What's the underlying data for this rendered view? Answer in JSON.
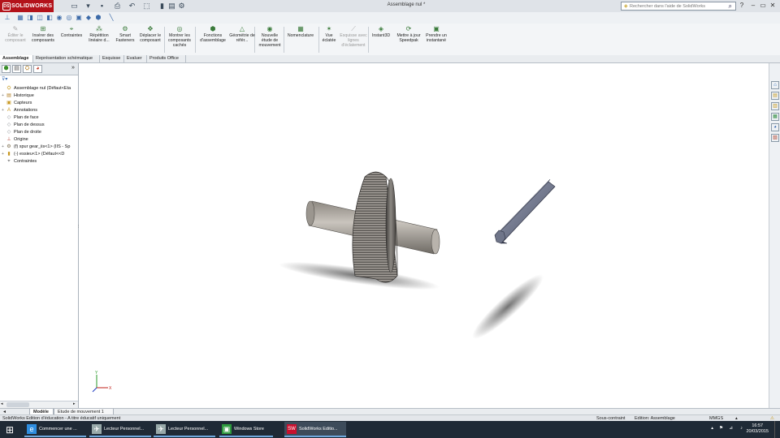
{
  "app": {
    "brand": "SOLIDWORKS",
    "ds_logo": "DS",
    "doc_title": "Assemblage nul *",
    "search_placeholder": "Rechercher dans l'aide de SolidWorks",
    "help_label": "?"
  },
  "quick_access": [
    {
      "name": "new-doc",
      "glyph": "▭"
    },
    {
      "name": "open",
      "glyph": "▾"
    },
    {
      "name": "save",
      "glyph": "▪"
    },
    {
      "name": "print",
      "glyph": "⎙"
    },
    {
      "name": "undo",
      "glyph": "↶"
    },
    {
      "name": "select",
      "glyph": "⬚"
    },
    {
      "name": "rebuild",
      "glyph": "▮"
    },
    {
      "name": "file-props",
      "glyph": "▤"
    },
    {
      "name": "options",
      "glyph": "⚙"
    }
  ],
  "command_manager": [
    {
      "label": "Éditer le composant",
      "glyph": "✎",
      "disabled": true
    },
    {
      "label": "Insérer des composants",
      "glyph": "⊞",
      "disabled": false
    },
    {
      "label": "Contraintes",
      "glyph": "⌖",
      "disabled": false
    },
    {
      "label": "Répétition linéaire d...",
      "glyph": "⁂",
      "disabled": false
    },
    {
      "label": "Smart Fasteners",
      "glyph": "⚙",
      "disabled": false
    },
    {
      "label": "Déplacer le composant",
      "glyph": "✥",
      "disabled": false
    },
    {
      "label": "Montrer les composants cachés",
      "glyph": "◎",
      "disabled": false
    },
    {
      "label": "Fonctions d'assemblage",
      "glyph": "⬢",
      "disabled": false
    },
    {
      "label": "Géométrie de référ...",
      "glyph": "△",
      "disabled": false
    },
    {
      "label": "Nouvelle étude de mouvement",
      "glyph": "◉",
      "disabled": false
    },
    {
      "label": "Nomenclature",
      "glyph": "▦",
      "disabled": false
    },
    {
      "label": "Vue éclatée",
      "glyph": "✶",
      "disabled": false
    },
    {
      "label": "Esquisse avec lignes d'éclatement",
      "glyph": "⟋",
      "disabled": true
    },
    {
      "label": "Instant3D",
      "glyph": "◈",
      "disabled": false
    },
    {
      "label": "Mettre à jour Speedpak",
      "glyph": "⟳",
      "disabled": false
    },
    {
      "label": "Prendre un instantané",
      "glyph": "▣",
      "disabled": false
    }
  ],
  "tabs": [
    {
      "label": "Assemblage",
      "active": true
    },
    {
      "label": "Représentation schématique",
      "active": false
    },
    {
      "label": "Esquisse",
      "active": false
    },
    {
      "label": "Evaluer",
      "active": false
    },
    {
      "label": "Produits Office",
      "active": false
    }
  ],
  "feature_tree": [
    {
      "label": "Assemblage nul  (Défaut<Eta",
      "icon": "⛭",
      "color": "#c79a1f",
      "indent": 0,
      "pm": ""
    },
    {
      "label": "Historique",
      "icon": "▤",
      "color": "#b07b1e",
      "indent": 1,
      "pm": "+"
    },
    {
      "label": "Capteurs",
      "icon": "▣",
      "color": "#c7961e",
      "indent": 1,
      "pm": ""
    },
    {
      "label": "Annotations",
      "icon": "A",
      "color": "#c7961e",
      "indent": 1,
      "pm": "+"
    },
    {
      "label": "Plan de face",
      "icon": "◇",
      "color": "#8a8f95",
      "indent": 1,
      "pm": ""
    },
    {
      "label": "Plan de dessus",
      "icon": "◇",
      "color": "#8a8f95",
      "indent": 1,
      "pm": ""
    },
    {
      "label": "Plan de droite",
      "icon": "◇",
      "color": "#8a8f95",
      "indent": 1,
      "pm": ""
    },
    {
      "label": "Origine",
      "icon": "⊥",
      "color": "#b23b2b",
      "indent": 1,
      "pm": ""
    },
    {
      "label": "(f) spur gear_iis<1> (IIS - Sp",
      "icon": "⚙",
      "color": "#7a6a4a",
      "indent": 1,
      "pm": "+"
    },
    {
      "label": "(-) essieu<1> (Défaut<<D",
      "icon": "▮",
      "color": "#c7961e",
      "indent": 1,
      "pm": "+"
    },
    {
      "label": "Contraintes",
      "icon": "⌖",
      "color": "#666",
      "indent": 1,
      "pm": ""
    }
  ],
  "bottom_tabs": [
    {
      "label": "Modèle",
      "active": true
    },
    {
      "label": "Etude de mouvement 1",
      "active": false
    }
  ],
  "status": {
    "left": "SolidWorks Edition d'éducation - A titre éducatif uniquement",
    "constraint": "Sous-contraint",
    "edit": "Edition: Assemblage",
    "units": "MMGS"
  },
  "taskbar": {
    "apps": [
      {
        "label": "Commencer une ...",
        "glyph": "e",
        "color": "#2f8ee0",
        "active": false
      },
      {
        "label": "Lecteur Personnel...",
        "glyph": "✈",
        "color": "#9aa",
        "active": false
      },
      {
        "label": "Lecteur Personnel...",
        "glyph": "✈",
        "color": "#9aa",
        "active": false
      },
      {
        "label": "Windows Store",
        "glyph": "▣",
        "color": "#2d9b3e",
        "active": false
      },
      {
        "label": "SolidWorks Editio...",
        "glyph": "SW",
        "color": "#c8102e",
        "active": true
      }
    ],
    "time": "16:57",
    "date": "20/03/2015"
  },
  "colors": {
    "sw_red": "#b3121a",
    "accent": "#3c6aa8",
    "taskbar": "#1f2a36"
  }
}
